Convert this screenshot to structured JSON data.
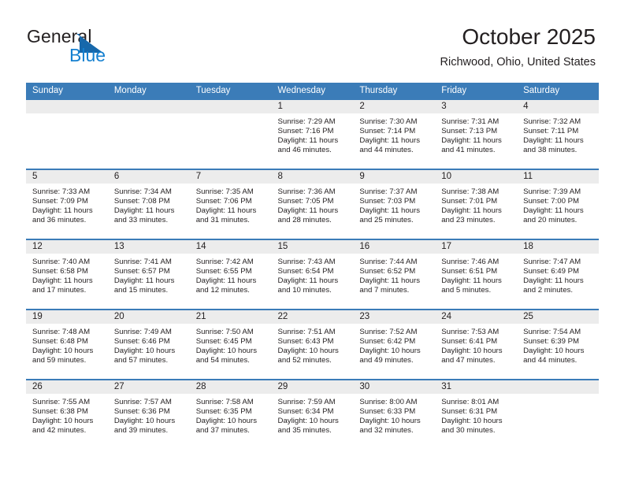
{
  "brand": {
    "name_part1": "General",
    "name_part2": "Blue",
    "triangle_color": "#1768ab",
    "blue_text_color": "#1580d0"
  },
  "header": {
    "month_title": "October 2025",
    "location": "Richwood, Ohio, United States",
    "header_bg_color": "#3b7cb8",
    "daynum_bg_color": "#ececec"
  },
  "weekday_headers": [
    "Sunday",
    "Monday",
    "Tuesday",
    "Wednesday",
    "Thursday",
    "Friday",
    "Saturday"
  ],
  "labels": {
    "sunrise_prefix": "Sunrise:",
    "sunset_prefix": "Sunset:",
    "daylight_prefix": "Daylight:"
  },
  "weeks": [
    [
      {
        "day": "",
        "empty": true
      },
      {
        "day": "",
        "empty": true
      },
      {
        "day": "",
        "empty": true
      },
      {
        "day": "1",
        "sunrise": "Sunrise: 7:29 AM",
        "sunset": "Sunset: 7:16 PM",
        "daylight_1": "Daylight: 11 hours",
        "daylight_2": "and 46 minutes."
      },
      {
        "day": "2",
        "sunrise": "Sunrise: 7:30 AM",
        "sunset": "Sunset: 7:14 PM",
        "daylight_1": "Daylight: 11 hours",
        "daylight_2": "and 44 minutes."
      },
      {
        "day": "3",
        "sunrise": "Sunrise: 7:31 AM",
        "sunset": "Sunset: 7:13 PM",
        "daylight_1": "Daylight: 11 hours",
        "daylight_2": "and 41 minutes."
      },
      {
        "day": "4",
        "sunrise": "Sunrise: 7:32 AM",
        "sunset": "Sunset: 7:11 PM",
        "daylight_1": "Daylight: 11 hours",
        "daylight_2": "and 38 minutes."
      }
    ],
    [
      {
        "day": "5",
        "sunrise": "Sunrise: 7:33 AM",
        "sunset": "Sunset: 7:09 PM",
        "daylight_1": "Daylight: 11 hours",
        "daylight_2": "and 36 minutes."
      },
      {
        "day": "6",
        "sunrise": "Sunrise: 7:34 AM",
        "sunset": "Sunset: 7:08 PM",
        "daylight_1": "Daylight: 11 hours",
        "daylight_2": "and 33 minutes."
      },
      {
        "day": "7",
        "sunrise": "Sunrise: 7:35 AM",
        "sunset": "Sunset: 7:06 PM",
        "daylight_1": "Daylight: 11 hours",
        "daylight_2": "and 31 minutes."
      },
      {
        "day": "8",
        "sunrise": "Sunrise: 7:36 AM",
        "sunset": "Sunset: 7:05 PM",
        "daylight_1": "Daylight: 11 hours",
        "daylight_2": "and 28 minutes."
      },
      {
        "day": "9",
        "sunrise": "Sunrise: 7:37 AM",
        "sunset": "Sunset: 7:03 PM",
        "daylight_1": "Daylight: 11 hours",
        "daylight_2": "and 25 minutes."
      },
      {
        "day": "10",
        "sunrise": "Sunrise: 7:38 AM",
        "sunset": "Sunset: 7:01 PM",
        "daylight_1": "Daylight: 11 hours",
        "daylight_2": "and 23 minutes."
      },
      {
        "day": "11",
        "sunrise": "Sunrise: 7:39 AM",
        "sunset": "Sunset: 7:00 PM",
        "daylight_1": "Daylight: 11 hours",
        "daylight_2": "and 20 minutes."
      }
    ],
    [
      {
        "day": "12",
        "sunrise": "Sunrise: 7:40 AM",
        "sunset": "Sunset: 6:58 PM",
        "daylight_1": "Daylight: 11 hours",
        "daylight_2": "and 17 minutes."
      },
      {
        "day": "13",
        "sunrise": "Sunrise: 7:41 AM",
        "sunset": "Sunset: 6:57 PM",
        "daylight_1": "Daylight: 11 hours",
        "daylight_2": "and 15 minutes."
      },
      {
        "day": "14",
        "sunrise": "Sunrise: 7:42 AM",
        "sunset": "Sunset: 6:55 PM",
        "daylight_1": "Daylight: 11 hours",
        "daylight_2": "and 12 minutes."
      },
      {
        "day": "15",
        "sunrise": "Sunrise: 7:43 AM",
        "sunset": "Sunset: 6:54 PM",
        "daylight_1": "Daylight: 11 hours",
        "daylight_2": "and 10 minutes."
      },
      {
        "day": "16",
        "sunrise": "Sunrise: 7:44 AM",
        "sunset": "Sunset: 6:52 PM",
        "daylight_1": "Daylight: 11 hours",
        "daylight_2": "and 7 minutes."
      },
      {
        "day": "17",
        "sunrise": "Sunrise: 7:46 AM",
        "sunset": "Sunset: 6:51 PM",
        "daylight_1": "Daylight: 11 hours",
        "daylight_2": "and 5 minutes."
      },
      {
        "day": "18",
        "sunrise": "Sunrise: 7:47 AM",
        "sunset": "Sunset: 6:49 PM",
        "daylight_1": "Daylight: 11 hours",
        "daylight_2": "and 2 minutes."
      }
    ],
    [
      {
        "day": "19",
        "sunrise": "Sunrise: 7:48 AM",
        "sunset": "Sunset: 6:48 PM",
        "daylight_1": "Daylight: 10 hours",
        "daylight_2": "and 59 minutes."
      },
      {
        "day": "20",
        "sunrise": "Sunrise: 7:49 AM",
        "sunset": "Sunset: 6:46 PM",
        "daylight_1": "Daylight: 10 hours",
        "daylight_2": "and 57 minutes."
      },
      {
        "day": "21",
        "sunrise": "Sunrise: 7:50 AM",
        "sunset": "Sunset: 6:45 PM",
        "daylight_1": "Daylight: 10 hours",
        "daylight_2": "and 54 minutes."
      },
      {
        "day": "22",
        "sunrise": "Sunrise: 7:51 AM",
        "sunset": "Sunset: 6:43 PM",
        "daylight_1": "Daylight: 10 hours",
        "daylight_2": "and 52 minutes."
      },
      {
        "day": "23",
        "sunrise": "Sunrise: 7:52 AM",
        "sunset": "Sunset: 6:42 PM",
        "daylight_1": "Daylight: 10 hours",
        "daylight_2": "and 49 minutes."
      },
      {
        "day": "24",
        "sunrise": "Sunrise: 7:53 AM",
        "sunset": "Sunset: 6:41 PM",
        "daylight_1": "Daylight: 10 hours",
        "daylight_2": "and 47 minutes."
      },
      {
        "day": "25",
        "sunrise": "Sunrise: 7:54 AM",
        "sunset": "Sunset: 6:39 PM",
        "daylight_1": "Daylight: 10 hours",
        "daylight_2": "and 44 minutes."
      }
    ],
    [
      {
        "day": "26",
        "sunrise": "Sunrise: 7:55 AM",
        "sunset": "Sunset: 6:38 PM",
        "daylight_1": "Daylight: 10 hours",
        "daylight_2": "and 42 minutes."
      },
      {
        "day": "27",
        "sunrise": "Sunrise: 7:57 AM",
        "sunset": "Sunset: 6:36 PM",
        "daylight_1": "Daylight: 10 hours",
        "daylight_2": "and 39 minutes."
      },
      {
        "day": "28",
        "sunrise": "Sunrise: 7:58 AM",
        "sunset": "Sunset: 6:35 PM",
        "daylight_1": "Daylight: 10 hours",
        "daylight_2": "and 37 minutes."
      },
      {
        "day": "29",
        "sunrise": "Sunrise: 7:59 AM",
        "sunset": "Sunset: 6:34 PM",
        "daylight_1": "Daylight: 10 hours",
        "daylight_2": "and 35 minutes."
      },
      {
        "day": "30",
        "sunrise": "Sunrise: 8:00 AM",
        "sunset": "Sunset: 6:33 PM",
        "daylight_1": "Daylight: 10 hours",
        "daylight_2": "and 32 minutes."
      },
      {
        "day": "31",
        "sunrise": "Sunrise: 8:01 AM",
        "sunset": "Sunset: 6:31 PM",
        "daylight_1": "Daylight: 10 hours",
        "daylight_2": "and 30 minutes."
      },
      {
        "day": "",
        "empty": true
      }
    ]
  ]
}
